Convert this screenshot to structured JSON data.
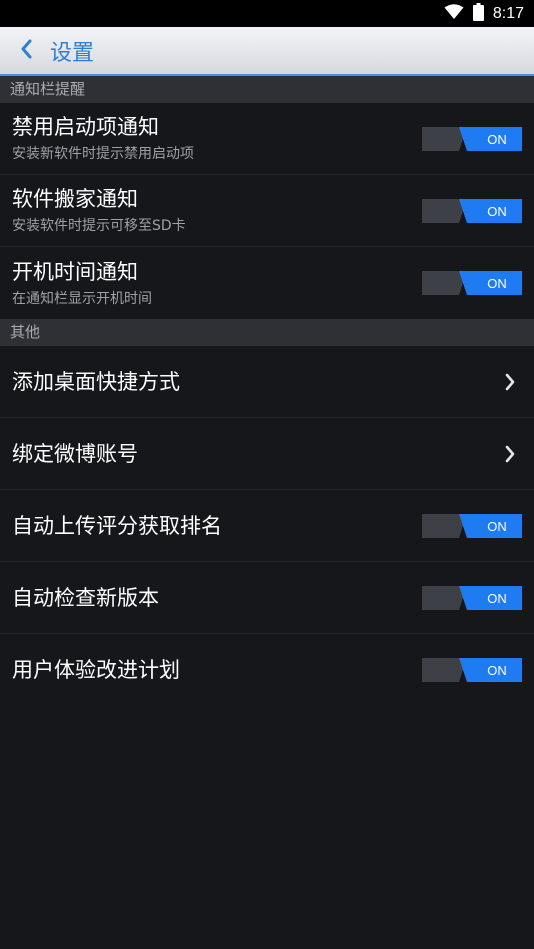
{
  "status_bar": {
    "time": "8:17",
    "icons": [
      "wifi-icon",
      "battery-icon"
    ]
  },
  "header": {
    "back_icon": "chevron-left-icon",
    "title": "设置"
  },
  "sections": [
    {
      "title": "通知栏提醒",
      "items": [
        {
          "title": "禁用启动项通知",
          "subtitle": "安装新软件时提示禁用启动项",
          "control": "toggle",
          "state": "ON"
        },
        {
          "title": "软件搬家通知",
          "subtitle": "安装软件时提示可移至SD卡",
          "control": "toggle",
          "state": "ON"
        },
        {
          "title": "开机时间通知",
          "subtitle": "在通知栏显示开机时间",
          "control": "toggle",
          "state": "ON"
        }
      ]
    },
    {
      "title": "其他",
      "items": [
        {
          "title": "添加桌面快捷方式",
          "control": "chevron"
        },
        {
          "title": "绑定微博账号",
          "control": "chevron"
        },
        {
          "title": "自动上传评分获取排名",
          "control": "toggle",
          "state": "ON"
        },
        {
          "title": "自动检查新版本",
          "control": "toggle",
          "state": "ON"
        },
        {
          "title": "用户体验改进计划",
          "control": "toggle",
          "state": "ON"
        }
      ]
    }
  ],
  "colors": {
    "accent": "#2d7fd3",
    "toggle_on": "#1f7bf2",
    "toggle_off": "#3d4046",
    "background": "#16171a",
    "section_header": "#2e3035"
  }
}
